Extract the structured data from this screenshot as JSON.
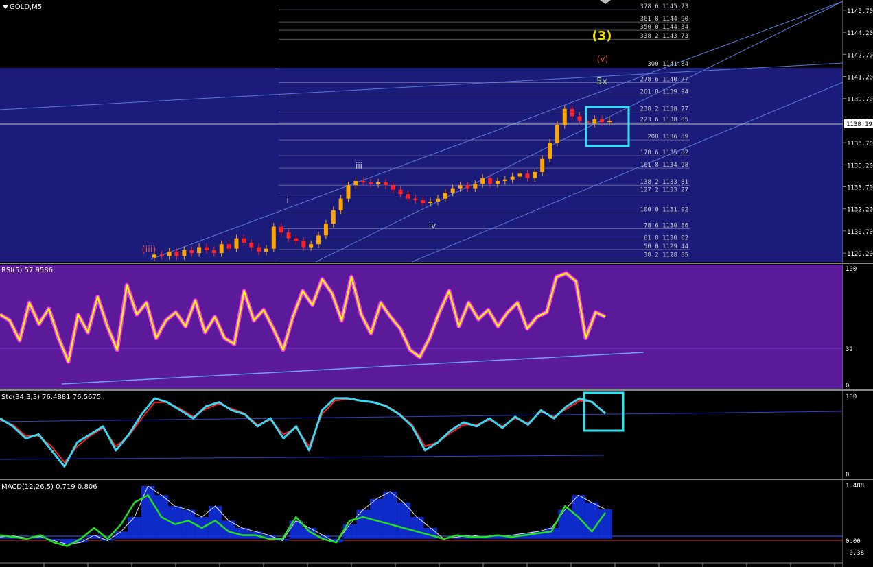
{
  "window": {
    "symbol_label": "GOLD,M5"
  },
  "price_axis": [
    "1145.70",
    "1144.20",
    "1142.70",
    "1141.20",
    "1139.70",
    "1138.19",
    "1136.70",
    "1135.20",
    "1133.70",
    "1132.20",
    "1130.70",
    "1129.20"
  ],
  "current_price_tag": "1138.19",
  "fib_levels": [
    {
      "label": "378.6 1145.73",
      "price": 1145.73
    },
    {
      "label": "361.8 1144.90",
      "price": 1144.9
    },
    {
      "label": "350.0 1144.34",
      "price": 1144.34
    },
    {
      "label": "338.2 1143.73",
      "price": 1143.73
    },
    {
      "label": "300 1141.84",
      "price": 1141.84
    },
    {
      "label": "278.6 1140.77",
      "price": 1140.77
    },
    {
      "label": "261.8 1139.94",
      "price": 1139.94
    },
    {
      "label": "238.2 1138.77",
      "price": 1138.77
    },
    {
      "label": "223.6 1138.05",
      "price": 1138.05
    },
    {
      "label": "200 1136.89",
      "price": 1136.89
    },
    {
      "label": "178.6 1135.82",
      "price": 1135.82
    },
    {
      "label": "161.8 1134.98",
      "price": 1134.98
    },
    {
      "label": "138.2 1133.81",
      "price": 1133.81
    },
    {
      "label": "127.2 1133.27",
      "price": 1133.27
    },
    {
      "label": "100.0 1131.92",
      "price": 1131.92
    },
    {
      "label": "78.6 1130.86",
      "price": 1130.86
    },
    {
      "label": "61.8 1130.02",
      "price": 1130.02
    },
    {
      "label": "50.0 1129.44",
      "price": 1129.44
    },
    {
      "label": "38.2 1128.85",
      "price": 1128.85
    }
  ],
  "wave_labels": [
    {
      "text": "(3)",
      "color": "#f0e000"
    },
    {
      "text": "(v)",
      "color": "#e05050"
    },
    {
      "text": "5x",
      "color": "#a0d080"
    },
    {
      "text": "iii",
      "color": "#d0d0d0"
    },
    {
      "text": "i",
      "color": "#d0d0d0"
    },
    {
      "text": "iv",
      "color": "#d0d0d0"
    },
    {
      "text": "(iii)",
      "color": "#e05050"
    }
  ],
  "rsi_panel": {
    "title": "RSI(5) 57.9586",
    "axis": [
      "100",
      "32",
      "0"
    ]
  },
  "sto_panel": {
    "title": "Sto(34,3,3) 76.4881 76.5675",
    "axis": [
      "100",
      "0"
    ]
  },
  "macd_panel": {
    "title": "MACD(12,26,5) 0.719 0.806",
    "axis": [
      "1.488",
      "0.00",
      "-0.38"
    ]
  },
  "colors": {
    "background": "#000000",
    "price_bg": "#1b1b7a",
    "rsi_bg": "#5a1a9a",
    "bull": "#ffa500",
    "bear": "#ff2020",
    "rsi_line": "#ffff00",
    "sto_main": "#3ad8f0",
    "sto_signal": "#ff2020",
    "macd_hist": "#1030e0",
    "macd_line": "#20e020",
    "highlight_box": "#30e0f0"
  },
  "chart_data": [
    {
      "type": "line",
      "title": "GOLD,M5",
      "ylim": [
        1128.6,
        1146.3
      ],
      "close": [
        1128.9,
        1129.1,
        1129.0,
        1129.3,
        1129.0,
        1129.4,
        1129.2,
        1129.6,
        1129.4,
        1129.2,
        1129.8,
        1129.5,
        1130.2,
        1129.9,
        1129.6,
        1129.3,
        1129.5,
        1131.0,
        1130.6,
        1130.2,
        1130.0,
        1129.6,
        1129.8,
        1130.4,
        1131.2,
        1132.1,
        1132.9,
        1133.8,
        1134.1,
        1134.0,
        1133.9,
        1134.0,
        1133.8,
        1133.5,
        1133.2,
        1132.9,
        1132.8,
        1132.6,
        1132.7,
        1132.9,
        1133.3,
        1133.6,
        1133.8,
        1133.6,
        1133.9,
        1134.3,
        1133.9,
        1134.1,
        1134.2,
        1134.4,
        1134.6,
        1134.3,
        1134.7,
        1135.6,
        1136.7,
        1137.9,
        1139.0,
        1138.5,
        1138.2,
        1138.0,
        1138.3,
        1138.1,
        1138.2
      ]
    },
    {
      "type": "line",
      "title": "RSI(5) 57.9586",
      "ylim": [
        0,
        100
      ],
      "values": [
        60,
        55,
        38,
        70,
        52,
        65,
        40,
        20,
        60,
        45,
        75,
        50,
        30,
        85,
        60,
        70,
        40,
        55,
        62,
        50,
        72,
        45,
        58,
        40,
        35,
        80,
        55,
        64,
        48,
        30,
        58,
        80,
        68,
        90,
        78,
        55,
        92,
        60,
        44,
        70,
        58,
        48,
        30,
        24,
        40,
        62,
        80,
        50,
        70,
        56,
        64,
        50,
        62,
        70,
        48,
        58,
        62,
        92,
        95,
        88,
        40,
        62,
        58
      ]
    },
    {
      "type": "line",
      "title": "Sto(34,3,3) 76.4881 76.5675",
      "ylim": [
        0,
        100
      ],
      "series": [
        {
          "values": [
            70,
            60,
            45,
            50,
            30,
            10,
            40,
            50,
            60,
            30,
            50,
            75,
            95,
            90,
            80,
            70,
            85,
            90,
            80,
            75,
            60,
            70,
            45,
            60,
            30,
            80,
            95,
            95,
            92,
            90,
            85,
            75,
            60,
            30,
            40,
            55,
            65,
            60,
            70,
            58,
            72,
            62,
            80,
            70,
            85,
            95,
            90,
            76
          ]
        },
        {
          "values": [
            68,
            62,
            48,
            48,
            35,
            15,
            35,
            48,
            58,
            35,
            48,
            70,
            90,
            90,
            82,
            72,
            82,
            88,
            82,
            76,
            62,
            68,
            50,
            58,
            35,
            75,
            92,
            94,
            92,
            90,
            86,
            76,
            62,
            35,
            40,
            52,
            62,
            62,
            68,
            60,
            70,
            64,
            78,
            72,
            82,
            92,
            90,
            77
          ]
        }
      ]
    },
    {
      "type": "bar",
      "title": "MACD(12,26,5) 0.719 0.806",
      "ylim": [
        -0.38,
        1.488
      ],
      "series": [
        {
          "values": [
            0.05,
            0.08,
            0.02,
            0.06,
            -0.05,
            -0.15,
            -0.1,
            0.1,
            -0.05,
            0.2,
            0.6,
            1.45,
            1.2,
            0.9,
            0.8,
            0.6,
            0.9,
            0.5,
            0.3,
            0.2,
            0.1,
            -0.05,
            0.5,
            0.3,
            0.1,
            -0.1,
            0.4,
            0.8,
            1.1,
            1.3,
            1.0,
            0.6,
            0.3,
            0.0,
            0.05,
            0.1,
            0.05,
            0.08,
            0.1,
            0.15,
            0.2,
            0.3,
            0.8,
            1.2,
            1.0,
            0.81
          ]
        },
        {
          "values": [
            0.1,
            0.05,
            0.0,
            0.1,
            -0.1,
            -0.2,
            0.0,
            0.3,
            0.0,
            0.4,
            1.0,
            1.2,
            0.6,
            0.4,
            0.5,
            0.3,
            0.5,
            0.2,
            0.1,
            0.1,
            0.0,
            0.0,
            0.6,
            0.2,
            0.0,
            -0.1,
            0.5,
            0.6,
            0.5,
            0.4,
            0.3,
            0.2,
            0.1,
            0.0,
            0.1,
            0.05,
            0.05,
            0.1,
            0.05,
            0.1,
            0.15,
            0.2,
            0.9,
            0.6,
            0.2,
            0.72
          ]
        }
      ]
    }
  ]
}
